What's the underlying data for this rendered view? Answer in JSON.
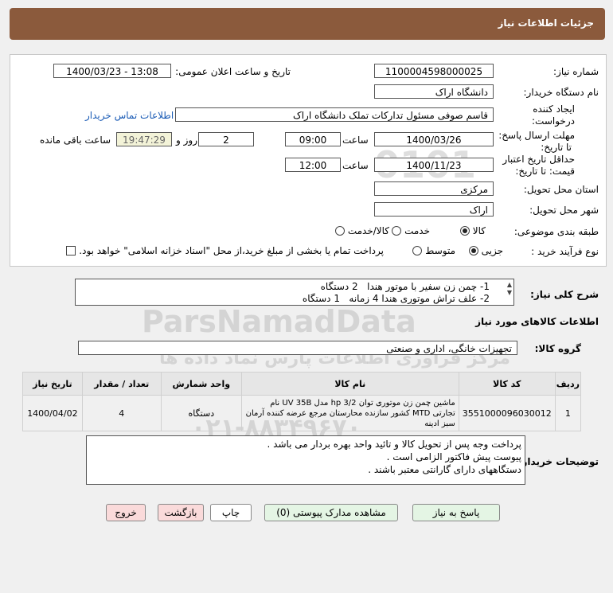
{
  "header": {
    "title": "جزئیات اطلاعات نیاز"
  },
  "form": {
    "need_number_label": "شماره نیاز:",
    "need_number": "1100004598000025",
    "announce_label": "تاریخ و ساعت اعلان عمومی:",
    "announce_value": "1400/03/23 - 13:08",
    "buyer_org_label": "نام دستگاه خریدار:",
    "buyer_org": "دانشگاه اراک",
    "creator_label_1": "ایجاد کننده",
    "creator_label_2": "درخواست:",
    "creator": "قاسم صوفی مسئول تدارکات تملک دانشگاه اراک",
    "contact_link": "اطلاعات تماس خریدار",
    "deadline_label_1": "مهلت ارسال پاسخ:",
    "deadline_label_2": "تا تاریخ:",
    "deadline_date": "1400/03/26",
    "time_label": "ساعت",
    "deadline_time": "09:00",
    "days_value": "2",
    "days_label": "روز و",
    "remaining_time": "19:47:29",
    "remaining_label": "ساعت باقی مانده",
    "validity_label_1": "حداقل تاریخ اعتبار",
    "validity_label_2": "قیمت: تا تاریخ:",
    "validity_date": "1400/11/23",
    "validity_time_label": "ساعت",
    "validity_time": "12:00",
    "province_label": "استان محل تحویل:",
    "province": "مرکزی",
    "city_label": "شهر محل تحویل:",
    "city": "اراک",
    "category_label": "طبقه بندی موضوعی:",
    "category_options": [
      "کالا",
      "خدمت",
      "کالا/خدمت"
    ],
    "category_selected": "کالا",
    "process_label": "نوع فرآیند خرید :",
    "process_options": [
      "جزیی",
      "متوسط"
    ],
    "process_selected": "جزیی",
    "payment_note": "پرداخت تمام یا بخشی از مبلغ خرید،از محل \"اسناد خزانه اسلامی\" خواهد بود."
  },
  "summary": {
    "label": "شرح کلی نیاز:",
    "line1": "1- چمن زن سفیر با موتور هندا   2 دستگاه",
    "line2": "2- علف تراش موتوری هندا 4 زمانه   1 دستگاه"
  },
  "goods": {
    "section_title": "اطلاعات کالاهای مورد نیاز",
    "group_label": "گروه کالا:",
    "group_value": "تجهیزات خانگی، اداری و صنعتی",
    "columns": [
      "ردیف",
      "کد کالا",
      "نام کالا",
      "واحد شمارش",
      "تعداد / مقدار",
      "تاریخ نیاز"
    ],
    "rows": [
      {
        "index": "1",
        "code": "3551000096030012",
        "name": "ماشین چمن زن موتوری توان hp 3/2 مدل UV 35B نام تجارتی MTD کشور سازنده محارستان مرجع عرضه کننده آرمان سبز ادینه",
        "unit": "دستگاه",
        "qty": "4",
        "date": "1400/04/02"
      }
    ]
  },
  "buyer_notes": {
    "label": "توضیحات خریدار:",
    "line1": "پرداخت وجه پس از تحویل کالا و تائید واحد بهره بردار می باشد .",
    "line2": "پیوست پیش فاکتور الزامی است .",
    "line3": "دستگاههای دارای گارانتی معتبر باشند ."
  },
  "buttons": {
    "reply": "پاسخ به نیاز",
    "attachments": "مشاهده مدارک پیوستی (0)",
    "print": "چاپ",
    "back": "بازگشت",
    "exit": "خروج"
  },
  "watermark": {
    "brand": "ParsNamadData",
    "tagline": "مرکز فرآوری اطلاعات پارس نماد داده ها",
    "phone": "۰۲۱-۸۸۳۴۹۶۷۰",
    "digits": "0101"
  }
}
